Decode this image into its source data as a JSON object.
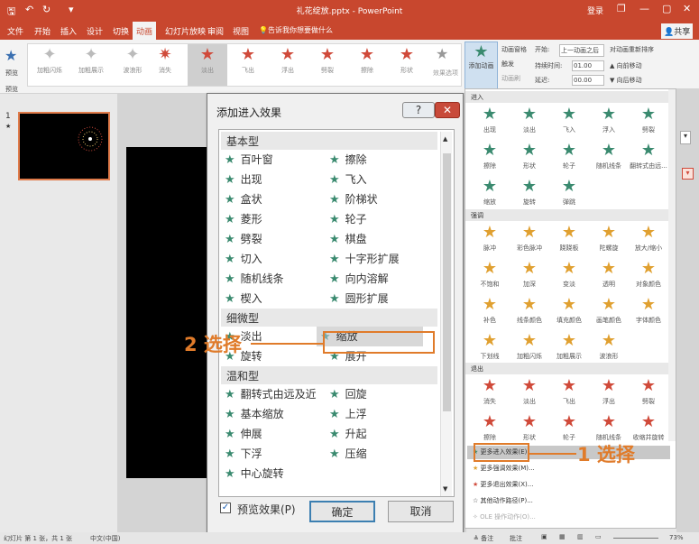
{
  "window": {
    "title": "礼花绽放.pptx - PowerPoint",
    "sign_in": "登录",
    "minimize": "—",
    "restore": "❐",
    "maximize": "▢",
    "close": "✕"
  },
  "qat": {
    "save": "🖫",
    "undo": "↶",
    "redo": "↻",
    "more": "▾"
  },
  "tabs": [
    "文件",
    "开始",
    "插入",
    "设计",
    "切换",
    "动画",
    "幻灯片放映",
    "审阅",
    "视图"
  ],
  "tell_me": "告诉我你想要做什么",
  "share": "共享",
  "ribbon": {
    "preview": "预览",
    "gallery": [
      "加粗闪烁",
      "加粗展示",
      "波浪形",
      "消失",
      "淡出",
      "飞出",
      "浮出",
      "劈裂",
      "擦除",
      "形状"
    ],
    "effect_options": "效果选项",
    "add_animation": "添加动画",
    "animation_pane": "动画窗格",
    "trigger": "触发",
    "animation_painter": "动画刷",
    "start_label": "开始:",
    "start_value": "上一动画之后",
    "duration_label": "持续时间:",
    "duration_value": "01.00",
    "delay_label": "延迟:",
    "delay_value": "00.00",
    "reorder": "对动画重新排序",
    "move_earlier": "▲ 向前移动",
    "move_later": "▼ 向后移动"
  },
  "slide_panel": {
    "number": "1",
    "star": "★"
  },
  "dialog": {
    "title": "添加进入效果",
    "help": "?",
    "close": "✕",
    "categories": [
      {
        "name": "基本型",
        "rows": [
          [
            "百叶窗",
            "擦除"
          ],
          [
            "出现",
            "飞入"
          ],
          [
            "盒状",
            "阶梯状"
          ],
          [
            "菱形",
            "轮子"
          ],
          [
            "劈裂",
            "棋盘"
          ],
          [
            "切入",
            "十字形扩展"
          ],
          [
            "随机线条",
            "向内溶解"
          ],
          [
            "楔入",
            "圆形扩展"
          ]
        ]
      },
      {
        "name": "细微型",
        "rows": [
          [
            "淡出",
            "缩放"
          ],
          [
            "旋转",
            "展开"
          ]
        ]
      },
      {
        "name": "温和型",
        "rows": [
          [
            "翻转式由远及近",
            "回旋"
          ],
          [
            "基本缩放",
            "上浮"
          ],
          [
            "伸展",
            "升起"
          ],
          [
            "下浮",
            "压缩"
          ],
          [
            "中心旋转",
            ""
          ]
        ]
      }
    ],
    "preview_check": "✓",
    "preview_label": "预览效果(P)",
    "ok": "确定",
    "cancel": "取消"
  },
  "pane": {
    "entrance_header": "进入",
    "entrance": [
      "出现",
      "淡出",
      "飞入",
      "浮入",
      "劈裂",
      "擦除",
      "形状",
      "轮子",
      "随机线条",
      "翻转式由远...",
      "缩放",
      "旋转",
      "弹跳"
    ],
    "emphasis_header": "强调",
    "emphasis": [
      "脉冲",
      "彩色脉冲",
      "跷跷板",
      "陀螺旋",
      "放大/缩小",
      "不饱和",
      "加深",
      "变淡",
      "透明",
      "对象颜色",
      "补色",
      "线条颜色",
      "填充颜色",
      "画笔颜色",
      "字体颜色",
      "下划线",
      "加粗闪烁",
      "加粗展示",
      "波浪形"
    ],
    "exit_header": "退出",
    "exit": [
      "消失",
      "淡出",
      "飞出",
      "浮出",
      "劈裂",
      "擦除",
      "形状",
      "轮子",
      "随机线条",
      "收缩并旋转"
    ],
    "menu": [
      "更多进入效果(E)...",
      "更多强调效果(M)...",
      "更多退出效果(X)...",
      "其他动作路径(P)...",
      "OLE 操作动作(O)..."
    ]
  },
  "annotations": {
    "step1": "1 选择",
    "step2": "2 选择"
  },
  "status": {
    "slide_info": "幻灯片 第 1 张，共 1 张",
    "language": "中文(中国)",
    "notes": "≜ 备注",
    "comments": "批注",
    "zoom": "73%"
  },
  "colors": {
    "accent": "#c8472e",
    "annotation": "#e07b2a",
    "star_green": "#3a8a6f",
    "star_yellow": "#e0a030",
    "star_red": "#d04a3a"
  }
}
